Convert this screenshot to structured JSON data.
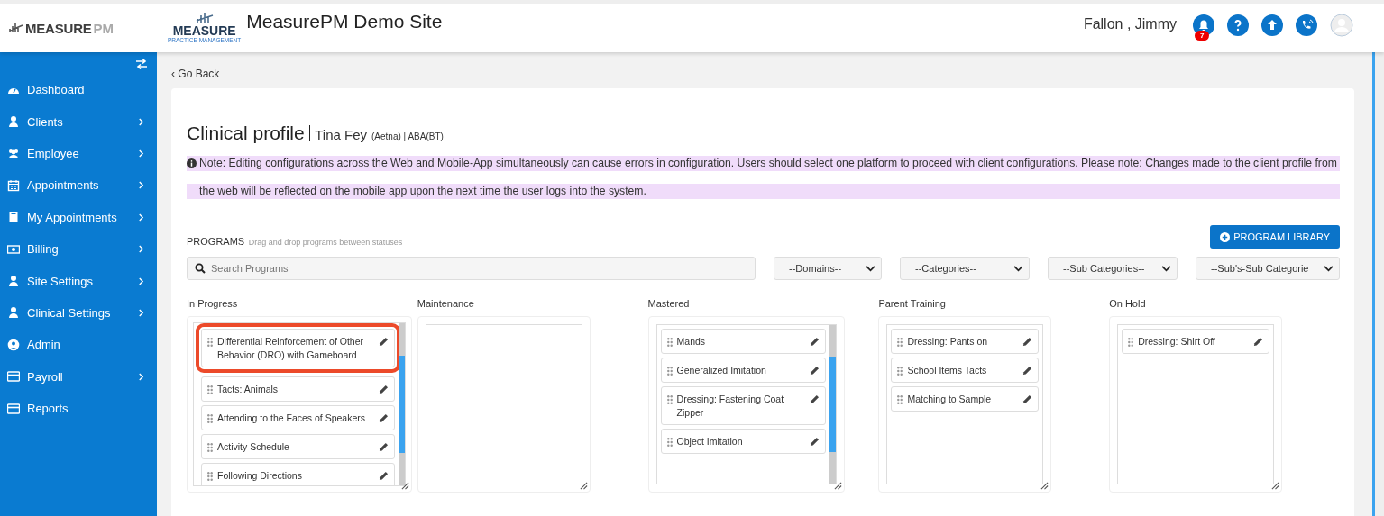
{
  "header": {
    "logo": {
      "main": "MEASURE",
      "accent": "PM"
    },
    "site_logo": {
      "main": "MEASURE",
      "sub": "PRACTICE MANAGEMENT"
    },
    "title": "MeasurePM Demo Site",
    "user": "Fallon , Jimmy",
    "notification_count": "7"
  },
  "sidebar": {
    "items": [
      {
        "label": "Dashboard",
        "chevron": false
      },
      {
        "label": "Clients",
        "chevron": true
      },
      {
        "label": "Employee",
        "chevron": true
      },
      {
        "label": "Appointments",
        "chevron": true
      },
      {
        "label": "My Appointments",
        "chevron": true
      },
      {
        "label": "Billing",
        "chevron": true
      },
      {
        "label": "Site Settings",
        "chevron": true
      },
      {
        "label": "Clinical Settings",
        "chevron": true
      },
      {
        "label": "Admin",
        "chevron": false
      },
      {
        "label": "Payroll",
        "chevron": true
      },
      {
        "label": "Reports",
        "chevron": false
      }
    ]
  },
  "back_link": "‹ Go Back",
  "profile": {
    "title": "Clinical profile",
    "client": "Tina Fey",
    "payer": "(Aetna) | ABA(BT)"
  },
  "note": "Note: Editing configurations across the Web and Mobile-App simultaneously can cause errors in configuration. Users should select one platform to proceed with client configurations. Please note: Changes made to the client profile from the web will be reflected on the mobile app upon the next time the user logs into the system.",
  "programs": {
    "title": "PROGRAMS",
    "hint": "Drag and drop programs between statuses",
    "library_button": "PROGRAM LIBRARY",
    "search": {
      "placeholder": "Search Programs"
    },
    "filters": [
      "--Domains--",
      "--Categories--",
      "--Sub Categories--",
      "--Sub's-Sub Categorie"
    ],
    "columns": [
      {
        "title": "In Progress",
        "scrollbar": true,
        "items": [
          {
            "label": "Differential Reinforcement of Other Behavior (DRO) with Gameboard",
            "highlighted": true
          },
          {
            "label": "Tacts: Animals",
            "highlighted": false
          },
          {
            "label": "Attending to the Faces of Speakers",
            "highlighted": false
          },
          {
            "label": "Activity Schedule",
            "highlighted": false
          },
          {
            "label": "Following Directions",
            "highlighted": false
          }
        ]
      },
      {
        "title": "Maintenance",
        "scrollbar": false
      },
      {
        "title": "Mastered",
        "scrollbar": true,
        "items": [
          {
            "label": "Mands",
            "highlighted": false
          },
          {
            "label": "Generalized Imitation",
            "highlighted": false
          },
          {
            "label": "Dressing: Fastening Coat Zipper",
            "highlighted": false
          },
          {
            "label": "Object Imitation",
            "highlighted": false
          }
        ]
      },
      {
        "title": "Parent Training",
        "scrollbar": false,
        "items": [
          {
            "label": "Dressing: Pants on",
            "highlighted": false
          },
          {
            "label": "School Items Tacts",
            "highlighted": false
          },
          {
            "label": "Matching to Sample",
            "highlighted": false
          }
        ]
      },
      {
        "title": "On Hold",
        "scrollbar": false,
        "items": [
          {
            "label": "Dressing: Shirt Off",
            "highlighted": false
          }
        ]
      }
    ]
  }
}
